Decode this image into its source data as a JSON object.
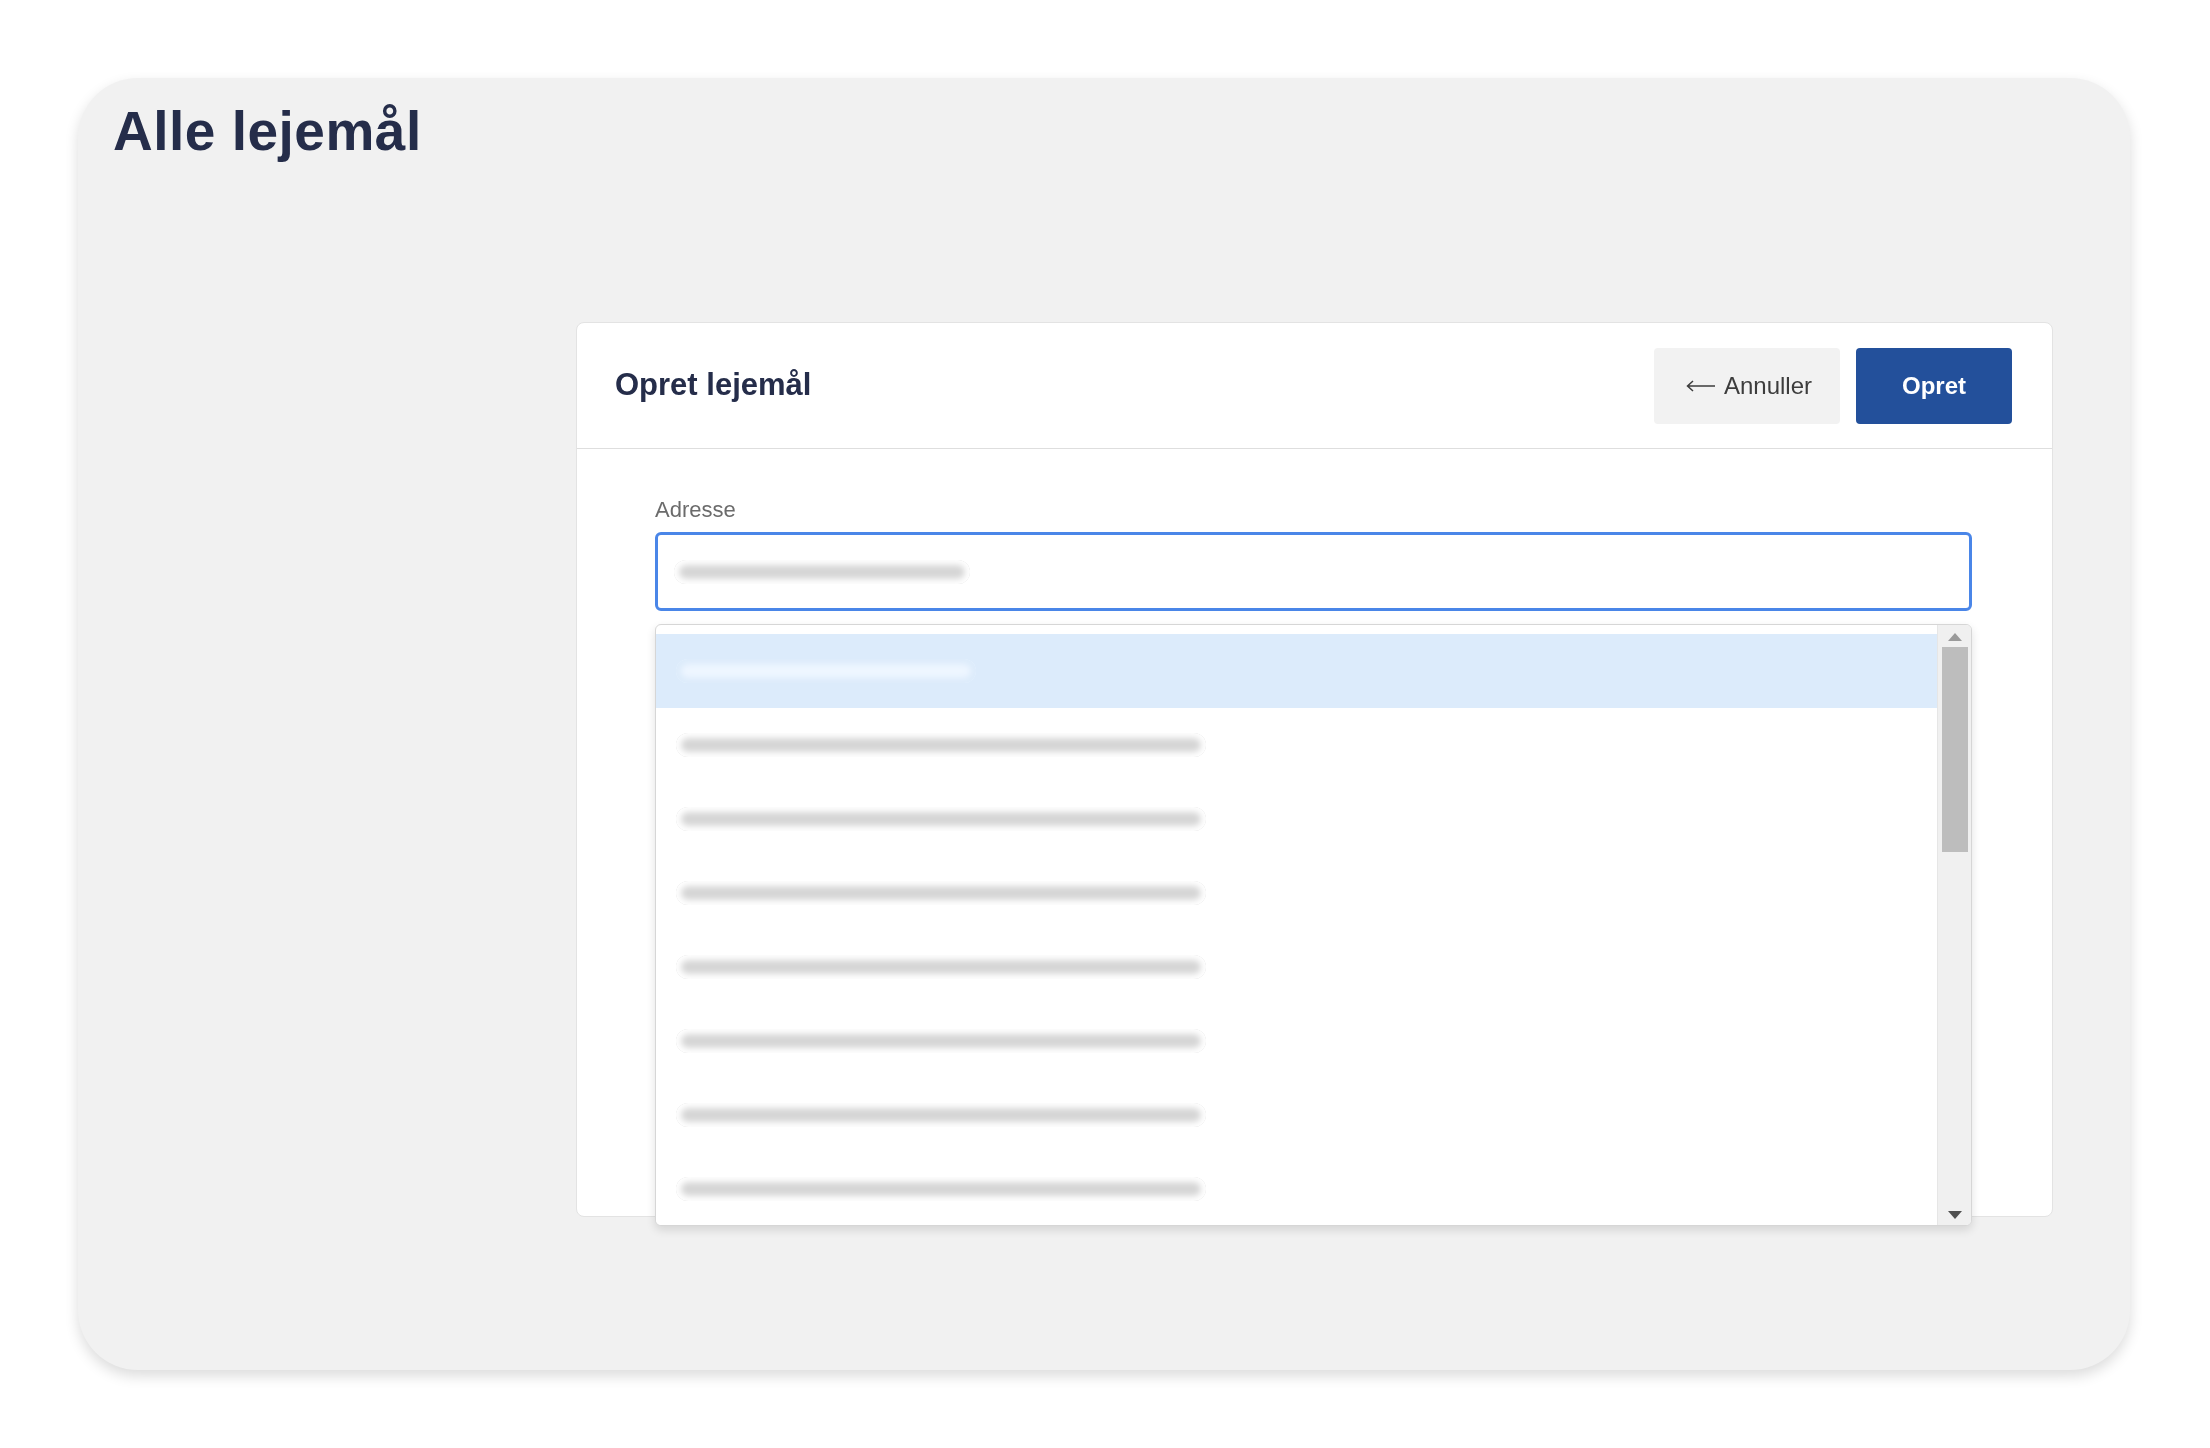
{
  "page": {
    "title": "Alle lejemål"
  },
  "dialog": {
    "title": "Opret lejemål",
    "buttons": [
      {
        "kind": "cancel",
        "label": "Annuller"
      },
      {
        "kind": "submit",
        "label": "Opret"
      }
    ]
  },
  "field": {
    "label": "Adresse",
    "focused": true
  },
  "suggestions": [
    {
      "kind": "query",
      "selected": true
    },
    {
      "kind": "address",
      "selected": false
    },
    {
      "kind": "address",
      "selected": false
    },
    {
      "kind": "address",
      "selected": false
    },
    {
      "kind": "address",
      "selected": false
    },
    {
      "kind": "address",
      "selected": false
    },
    {
      "kind": "address",
      "selected": false
    },
    {
      "kind": "address",
      "selected": false
    }
  ]
}
